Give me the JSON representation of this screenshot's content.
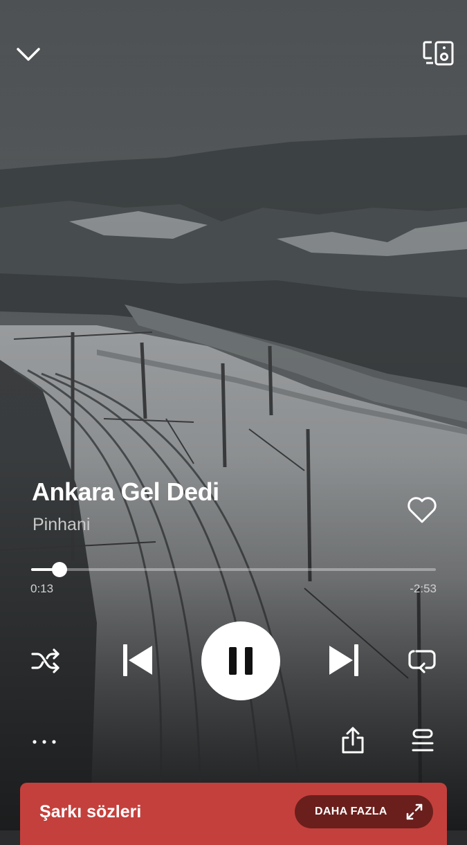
{
  "player": {
    "track_title": "Ankara Gel Dedi",
    "artist": "Pinhani",
    "elapsed": "0:13",
    "remaining": "-2:53",
    "progress": 0.07,
    "liked": false,
    "playing": true
  },
  "lyrics": {
    "title": "Şarkı sözleri",
    "more_label": "DAHA FAZLA"
  },
  "colors": {
    "lyrics_bg": "#c4403c",
    "more_bg": "#6a1f1c",
    "text": "#ffffff"
  },
  "icons": [
    "chevron-down-icon",
    "connect-device-icon",
    "heart-icon",
    "shuffle-icon",
    "previous-icon",
    "pause-icon",
    "next-icon",
    "repeat-icon",
    "more-options-icon",
    "share-icon",
    "queue-icon",
    "expand-icon"
  ]
}
